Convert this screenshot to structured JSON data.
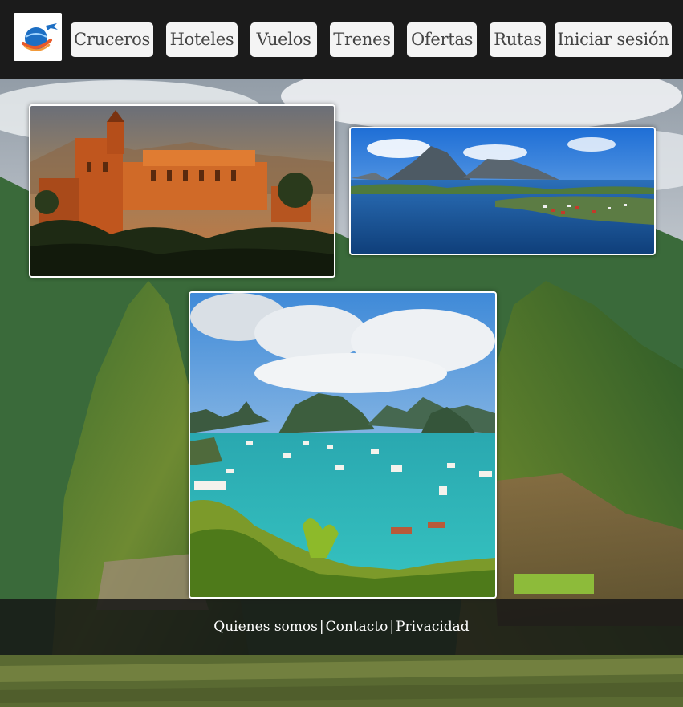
{
  "nav": {
    "items": [
      {
        "label": "Cruceros"
      },
      {
        "label": "Hoteles"
      },
      {
        "label": "Vuelos"
      },
      {
        "label": "Trenes"
      },
      {
        "label": "Ofertas"
      },
      {
        "label": "Rutas"
      },
      {
        "label": "Iniciar sesión"
      }
    ]
  },
  "footer": {
    "links": [
      {
        "label": "Quienes somos"
      },
      {
        "label": "Contacto"
      },
      {
        "label": "Privacidad"
      }
    ],
    "separator": "|"
  },
  "colors": {
    "header_bg": "#1b1b1b",
    "nav_button_bg": "#f4f4f4",
    "nav_text": "#444444",
    "footer_text": "#ffffff"
  },
  "icons": {
    "logo": "globe-plane-logo-icon"
  }
}
